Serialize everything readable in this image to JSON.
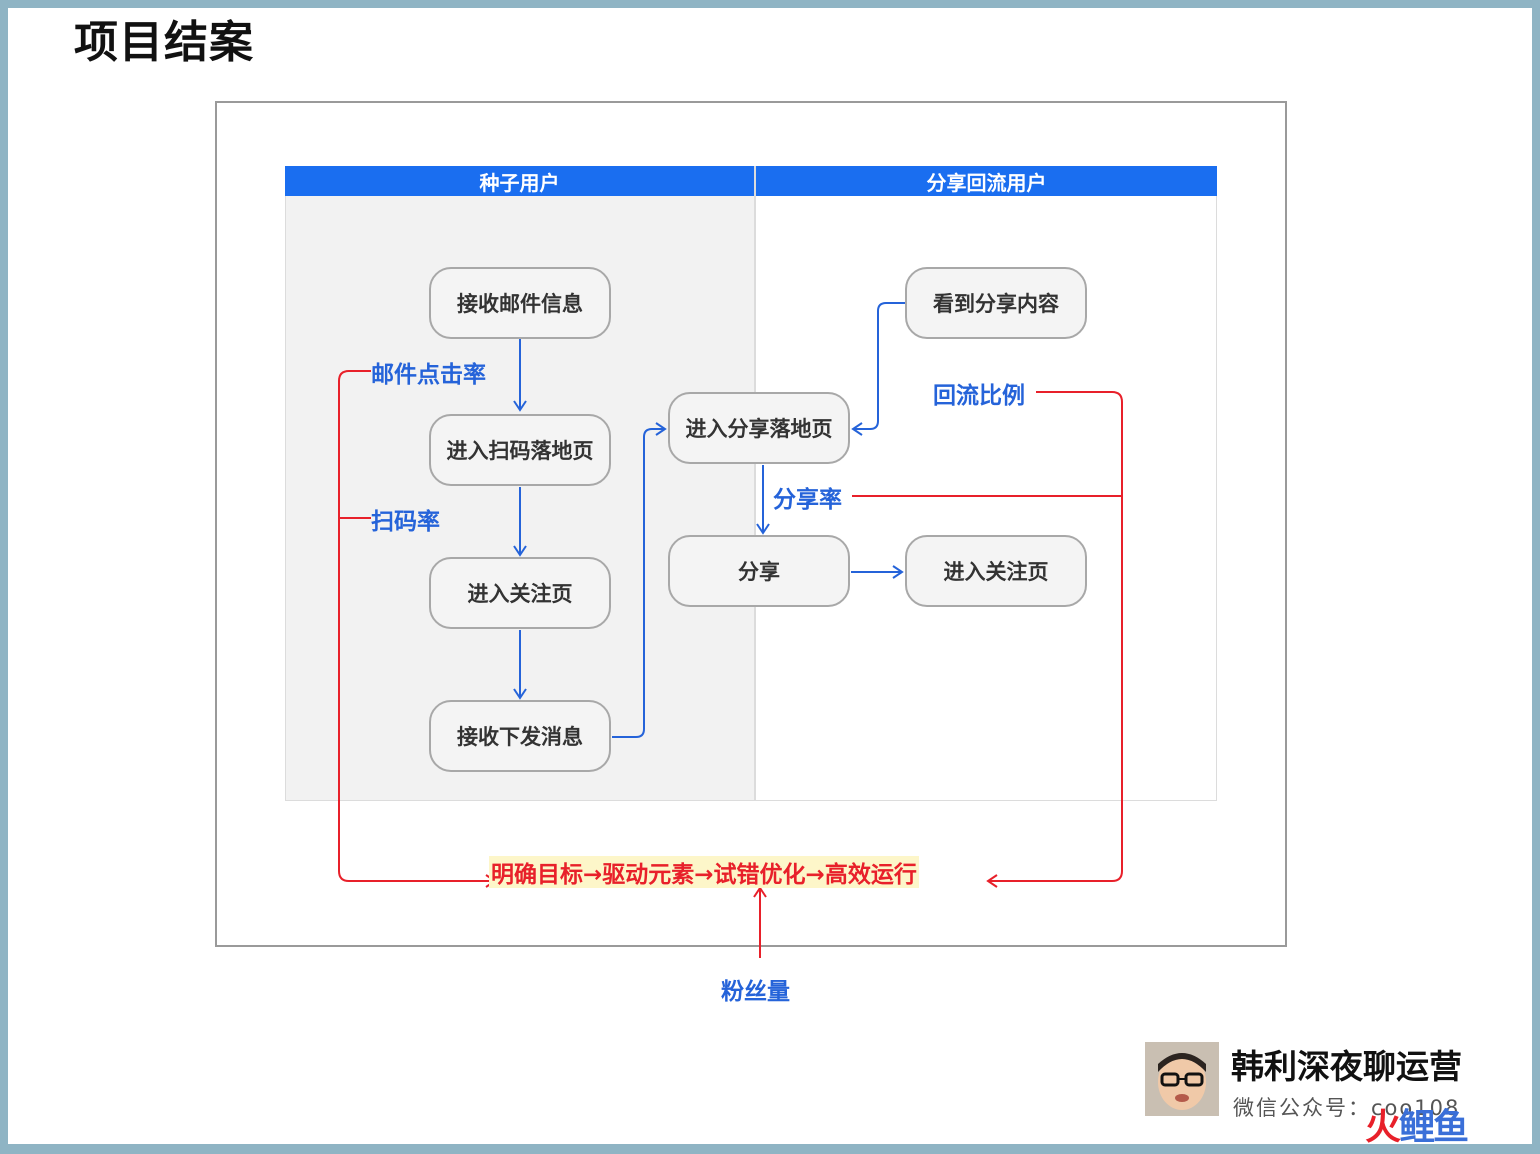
{
  "title": "项目结案",
  "lanes": {
    "left": "种子用户",
    "right": "分享回流用户"
  },
  "nodes": {
    "receive_email": "接收邮件信息",
    "scan_landing": "进入扫码落地页",
    "follow_page_left": "进入关注页",
    "receive_push": "接收下发消息",
    "share_landing": "进入分享落地页",
    "see_share": "看到分享内容",
    "share": "分享",
    "follow_page_right": "进入关注页"
  },
  "labels": {
    "email_ctr": "邮件点击率",
    "scan_rate": "扫码率",
    "share_rate": "分享率",
    "return_ratio": "回流比例",
    "fans": "粉丝量"
  },
  "banner": "明确目标→驱动元素→试错优化→高效运行",
  "brand": {
    "name": "韩利深夜聊运营",
    "subtitle": "微信公众号：coo108",
    "watermark_part1": "火",
    "watermark_part2": "鲤鱼"
  },
  "colors": {
    "lane_header": "#1a6ef0",
    "flow_blue": "#2563d9",
    "metric_red": "#e8202a"
  }
}
